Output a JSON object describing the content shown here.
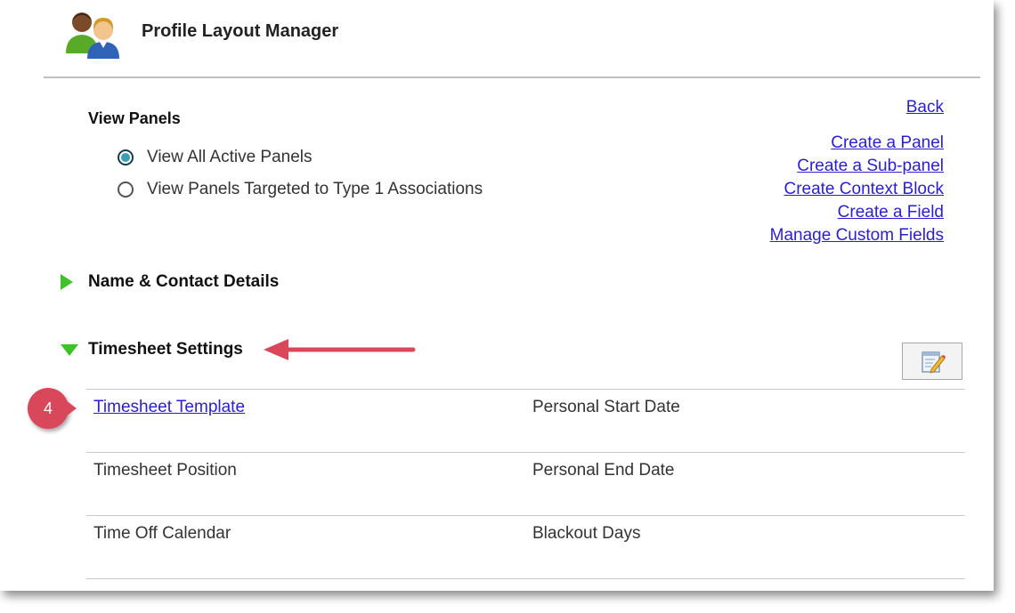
{
  "header": {
    "title": "Profile Layout Manager",
    "icon": "users-icon"
  },
  "view_panels": {
    "title": "View Panels",
    "options": [
      {
        "label": "View All Active Panels",
        "checked": true
      },
      {
        "label": "View Panels Targeted to Type 1 Associations",
        "checked": false
      }
    ]
  },
  "links": {
    "back": "Back",
    "items": [
      "Create a Panel",
      "Create a Sub-panel",
      "Create Context Block",
      "Create a Field",
      "Manage Custom Fields"
    ]
  },
  "sections": {
    "name_contact": "Name & Contact Details",
    "timesheet": "Timesheet Settings"
  },
  "timesheet_fields": [
    [
      "Timesheet Template",
      "Personal Start Date"
    ],
    [
      "Timesheet Position",
      "Personal End Date"
    ],
    [
      "Time Off Calendar",
      "Blackout Days"
    ]
  ],
  "annotation": {
    "step": "4",
    "accent": "#d9475a"
  },
  "colors": {
    "link": "#2a1fd0",
    "expand_triangle": "#3fc12a",
    "radio_selected": "#3a9eb5"
  }
}
